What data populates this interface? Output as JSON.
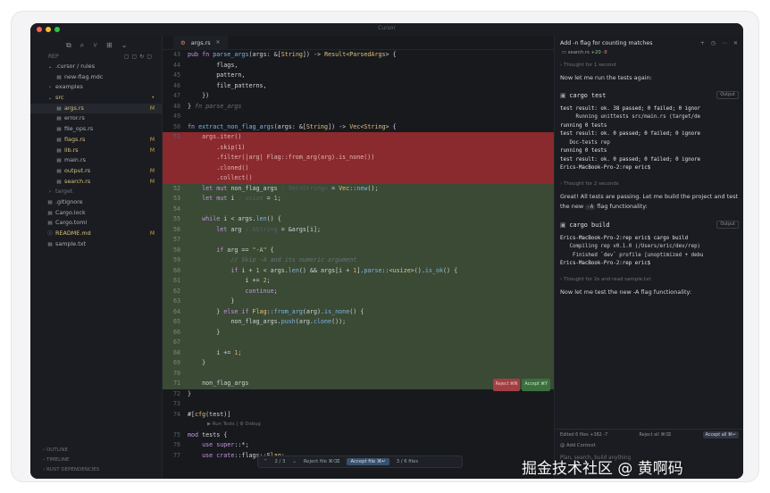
{
  "window": {
    "title": "Cursor",
    "traffic": [
      "#ff5f57",
      "#febc2e",
      "#28c840"
    ]
  },
  "sidebar": {
    "section_title": "REP",
    "tree": [
      {
        "label": ".cursor / rules",
        "icon": "chevron-down",
        "indent": 1
      },
      {
        "label": "new-flag.mdc",
        "icon": "file",
        "indent": 2
      },
      {
        "label": "examples",
        "icon": "chevron-right",
        "indent": 1
      },
      {
        "label": "src",
        "icon": "chevron-down",
        "indent": 1,
        "status": "•",
        "mod": true
      },
      {
        "label": "args.rs",
        "icon": "file",
        "indent": 2,
        "status": "M",
        "mod": true,
        "selected": true
      },
      {
        "label": "error.rs",
        "icon": "file",
        "indent": 2
      },
      {
        "label": "file_ops.rs",
        "icon": "file",
        "indent": 2
      },
      {
        "label": "flags.rs",
        "icon": "file",
        "indent": 2,
        "status": "M",
        "mod": true
      },
      {
        "label": "lib.rs",
        "icon": "file",
        "indent": 2,
        "status": "M",
        "mod": true
      },
      {
        "label": "main.rs",
        "icon": "file",
        "indent": 2
      },
      {
        "label": "output.rs",
        "icon": "file",
        "indent": 2,
        "status": "M",
        "mod": true
      },
      {
        "label": "search.rs",
        "icon": "file",
        "indent": 2,
        "status": "M",
        "mod": true
      },
      {
        "label": "target",
        "icon": "chevron-right",
        "indent": 1,
        "dim": true
      },
      {
        "label": ".gitignore",
        "icon": "file",
        "indent": 1
      },
      {
        "label": "Cargo.lock",
        "icon": "file",
        "indent": 1
      },
      {
        "label": "Cargo.toml",
        "icon": "file",
        "indent": 1
      },
      {
        "label": "README.md",
        "icon": "info",
        "indent": 1,
        "status": "M",
        "mod": true
      },
      {
        "label": "sample.txt",
        "icon": "file",
        "indent": 1
      }
    ],
    "footer": [
      "OUTLINE",
      "TIMELINE",
      "RUST DEPENDENCIES"
    ]
  },
  "editor": {
    "tab": "args.rs",
    "accept_hunk": {
      "reject": "Reject ⌘N",
      "accept": "Accept ⌘Y"
    },
    "hint": "▶ Run Tests | ⚙ Debug",
    "review_bar": {
      "counter": "2 / 3",
      "reject": "Reject file ⌘⌫",
      "accept": "Accept file ⌘↵",
      "files": "3 / 6 files"
    },
    "lines": [
      {
        "n": "43",
        "html": "<span class='kw'>pub fn</span> <span class='fn'>parse_args</span>(args: &amp;[<span class='ty'>String</span>]) -&gt; <span class='ty'>Result</span>&lt;<span class='ty'>ParsedArgs</span>&gt; {"
      },
      {
        "n": "44",
        "html": "        flags,"
      },
      {
        "n": "45",
        "html": "        pattern,"
      },
      {
        "n": "46",
        "html": "        file_patterns,"
      },
      {
        "n": "47",
        "html": "    })"
      },
      {
        "n": "48",
        "html": "} <span class='cm'>fn parse_args</span>"
      },
      {
        "n": "49",
        "html": ""
      },
      {
        "n": "50",
        "html": "<span class='kw'>fn</span> <span class='fn'>extract_non_flag_args</span>(args: &amp;[<span class='ty'>String</span>]) -&gt; <span class='ty'>Vec</span>&lt;<span class='ty'>String</span>&gt; {"
      },
      {
        "n": "51",
        "html": "    args.iter()",
        "cls": "del"
      },
      {
        "n": "",
        "html": "        .skip(1)",
        "cls": "del"
      },
      {
        "n": "",
        "html": "        .filter(|arg| Flag::from_arg(arg).is_none())",
        "cls": "del"
      },
      {
        "n": "",
        "html": "        .cloned()",
        "cls": "del"
      },
      {
        "n": "",
        "html": "        .collect()",
        "cls": "del"
      },
      {
        "n": "52",
        "html": "    <span class='kw'>let mut</span> non_flag_args <span class='ht'>: Vec&lt;String&gt;</span> = <span class='ty'>Vec</span>::<span class='fn'>new</span>();",
        "cls": "add"
      },
      {
        "n": "53",
        "html": "    <span class='kw'>let mut</span> i <span class='ht'>: usize</span> = <span class='nu'>1</span>;",
        "cls": "add"
      },
      {
        "n": "54",
        "html": "",
        "cls": "add"
      },
      {
        "n": "55",
        "html": "    <span class='kw'>while</span> i &lt; args.<span class='fn'>len</span>() {",
        "cls": "add"
      },
      {
        "n": "56",
        "html": "        <span class='kw'>let</span> arg <span class='ht'>: &amp;String</span> = &amp;args[i];",
        "cls": "add"
      },
      {
        "n": "57",
        "html": "",
        "cls": "add"
      },
      {
        "n": "58",
        "html": "        <span class='kw'>if</span> arg == <span class='st'>\"-A\"</span> {",
        "cls": "add"
      },
      {
        "n": "59",
        "html": "            <span class='cm'>// Skip -A and its numeric argument</span>",
        "cls": "add"
      },
      {
        "n": "60",
        "html": "            <span class='kw'>if</span> i + <span class='nu'>1</span> &lt; args.<span class='fn'>len</span>() &amp;&amp; args[i + <span class='nu'>1</span>].<span class='fn'>parse</span>::&lt;<span class='ty'>usize</span>&gt;().<span class='fn'>is_ok</span>() {",
        "cls": "add"
      },
      {
        "n": "61",
        "html": "                i += <span class='nu'>2</span>;",
        "cls": "add"
      },
      {
        "n": "62",
        "html": "                <span class='kw'>continue</span>;",
        "cls": "add"
      },
      {
        "n": "63",
        "html": "            }",
        "cls": "add"
      },
      {
        "n": "64",
        "html": "        } <span class='kw'>else if</span> <span class='ty'>Flag</span>::<span class='fn'>from_arg</span>(arg).<span class='fn'>is_none</span>() {",
        "cls": "add"
      },
      {
        "n": "65",
        "html": "            non_flag_args.<span class='fn'>push</span>(arg.<span class='fn'>clone</span>());",
        "cls": "add"
      },
      {
        "n": "66",
        "html": "        }",
        "cls": "add"
      },
      {
        "n": "67",
        "html": "",
        "cls": "add"
      },
      {
        "n": "68",
        "html": "        i += <span class='nu'>1</span>;",
        "cls": "add"
      },
      {
        "n": "69",
        "html": "    }",
        "cls": "add"
      },
      {
        "n": "70",
        "html": "",
        "cls": "add"
      },
      {
        "n": "71",
        "html": "    non_flag_args",
        "cls": "add",
        "badges": true
      },
      {
        "n": "72",
        "html": "}"
      },
      {
        "n": "73",
        "html": ""
      },
      {
        "n": "74",
        "html": "#[<span class='ty'>cfg</span>(test)]"
      },
      {
        "n": "",
        "html": "",
        "hint": true
      },
      {
        "n": "75",
        "html": "<span class='kw'>mod</span> tests {"
      },
      {
        "n": "76",
        "html": "    <span class='kw'>use super</span>::*;"
      },
      {
        "n": "77",
        "html": "    <span class='kw'>use crate</span>::flags::<span class='ty'>Flag</span>;"
      }
    ]
  },
  "panel": {
    "title": "Add -n flag for counting matches",
    "file": {
      "name": "search.rs",
      "added": "+20",
      "removed": "-8"
    },
    "thought1": "Thought for 1 second",
    "text1": "Now let me run the tests again:",
    "cmd1": {
      "icon": "terminal",
      "cmd": "cargo test",
      "pill": "Output"
    },
    "out1": [
      {
        "t": "test result: ok. 38 passed; 0 failed; 0 ignor",
        "b": true
      },
      {
        "t": "     Running unittests src/main.rs (target/de"
      },
      {
        "t": "running 0 tests",
        "b": true
      },
      {
        "t": "test result: ok. 0 passed; 0 failed; 0 ignore",
        "b": true
      },
      {
        "t": "   Doc-tests rep"
      },
      {
        "t": "running 0 tests",
        "b": true
      },
      {
        "t": "test result: ok. 0 passed; 0 failed; 0 ignore",
        "b": true
      },
      {
        "t": "Erics-MacBook-Pro-2:rep eric$",
        "b": true
      }
    ],
    "thought2": "Thought for 2 seconds",
    "text2a": "Great! All tests are passing. Let me build the project and test the new ",
    "text2chip": "-A",
    "text2b": " flag functionality:",
    "cmd2": {
      "icon": "terminal",
      "cmd": "cargo build",
      "pill": "Output"
    },
    "out2": [
      {
        "t": "Erics-MacBook-Pro-2:rep eric$ cargo build",
        "b": true
      },
      {
        "t": "   Compiling rep v0.1.0 (/Users/eric/dev/rep)"
      },
      {
        "t": "    Finished `dev` profile [unoptimized + debu"
      },
      {
        "t": "Erics-MacBook-Pro-2:rep eric$",
        "b": true
      }
    ],
    "thought3": "Thought for 2s and read sample.txt",
    "text3": "Now let me test the new -A flag functionality:",
    "bar": {
      "edited": "Edited 6 files +382 -7",
      "reject": "Reject all ⌘⌫",
      "accept": "Accept all ⌘↵"
    },
    "context": "Add Context",
    "placeholder": "Plan, search, build anything"
  },
  "watermark": "掘金技术社区 @ 黄啊码"
}
